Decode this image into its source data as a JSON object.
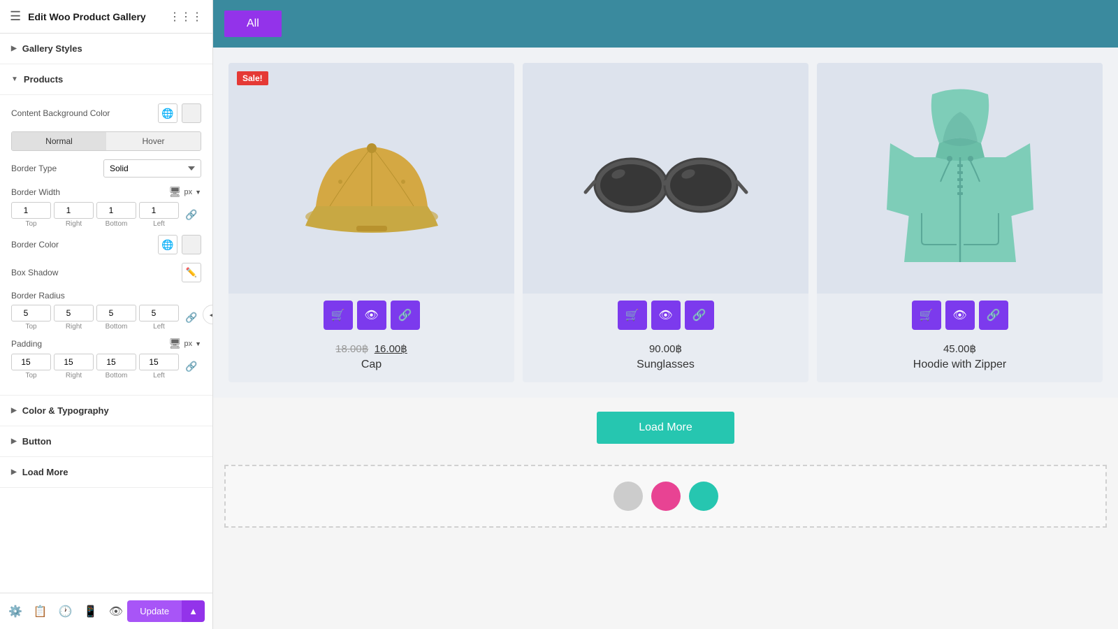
{
  "header": {
    "title": "Edit Woo Product Gallery",
    "hamburger": "☰",
    "grid": "⋮⋮⋮"
  },
  "sidebar": {
    "sections": [
      {
        "id": "gallery-styles",
        "label": "Gallery Styles",
        "expanded": false
      },
      {
        "id": "products",
        "label": "Products",
        "expanded": true
      },
      {
        "id": "color-typography",
        "label": "Color & Typography",
        "expanded": false
      },
      {
        "id": "button",
        "label": "Button",
        "expanded": false
      },
      {
        "id": "load-more",
        "label": "Load More",
        "expanded": false
      }
    ],
    "products": {
      "content_bg_label": "Content Background Color",
      "tabs": {
        "normal": "Normal",
        "hover": "Hover",
        "active": "normal"
      },
      "border_type_label": "Border Type",
      "border_type_value": "Solid",
      "border_width_label": "Border Width",
      "border_width_unit": "px",
      "border_top": "1",
      "border_right": "1",
      "border_bottom": "1",
      "border_left": "1",
      "border_color_label": "Border Color",
      "box_shadow_label": "Box Shadow",
      "border_radius_label": "Border Radius",
      "br_top": "5",
      "br_right": "5",
      "br_bottom": "5",
      "br_left": "5",
      "padding_label": "Padding",
      "padding_unit": "px",
      "pad_top": "15",
      "pad_right": "15",
      "pad_bottom": "15",
      "pad_left": "15"
    }
  },
  "footer": {
    "update_label": "Update",
    "chevron": "▲"
  },
  "main": {
    "filter": {
      "all_label": "All"
    },
    "products": [
      {
        "id": 1,
        "name": "Cap",
        "price_original": "18.00฿",
        "price_sale": "16.00฿",
        "has_sale": true,
        "sale_badge": "Sale!",
        "color": "#c8b96e"
      },
      {
        "id": 2,
        "name": "Sunglasses",
        "price": "90.00฿",
        "has_sale": false,
        "color": "#888"
      },
      {
        "id": 3,
        "name": "Hoodie with Zipper",
        "price": "45.00฿",
        "has_sale": false,
        "color": "#7ecdb8"
      }
    ],
    "load_more": "Load More",
    "action_cart": "🛒",
    "action_eye": "👁",
    "action_link": "🔗"
  }
}
